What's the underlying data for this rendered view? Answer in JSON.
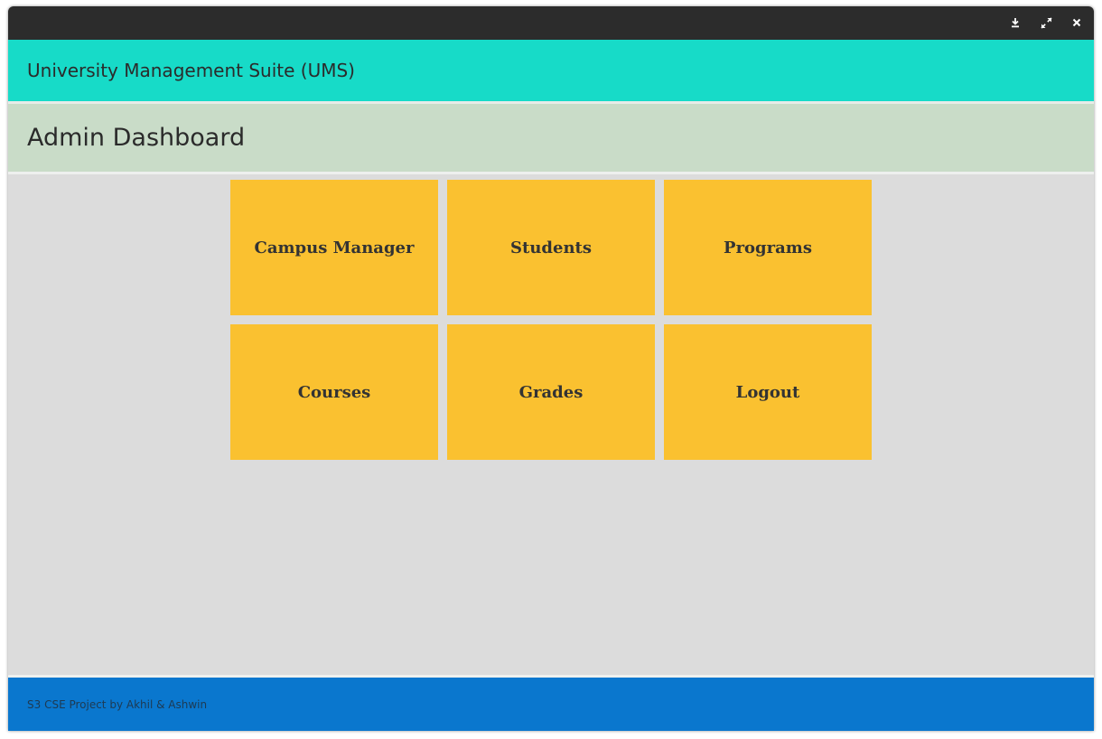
{
  "window": {
    "controls": {
      "minimize_icon": "download-icon",
      "maximize_icon": "expand-icon",
      "close_icon": "close-icon"
    }
  },
  "app": {
    "title": "University Management Suite (UMS)"
  },
  "page": {
    "title": "Admin Dashboard"
  },
  "tiles": [
    {
      "label": "Campus Manager"
    },
    {
      "label": "Students"
    },
    {
      "label": "Programs"
    },
    {
      "label": "Courses"
    },
    {
      "label": "Grades"
    },
    {
      "label": "Logout"
    }
  ],
  "footer": {
    "text": "S3 CSE Project by Akhil & Ashwin"
  },
  "colors": {
    "titlebar": "#2c2c2c",
    "app_header": "#17dbc8",
    "page_header": "#c9dcc8",
    "content_bg": "#dcdcdc",
    "tile": "#fac130",
    "footer": "#0a77ce"
  }
}
